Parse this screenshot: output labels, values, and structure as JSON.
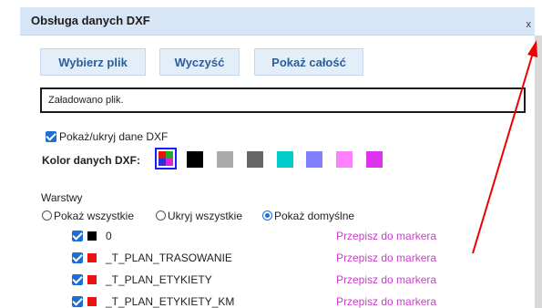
{
  "panel": {
    "title": "Obsługa danych DXF",
    "close_glyph": "x",
    "buttons": [
      "Wybierz plik",
      "Wyczyść",
      "Pokaż całość"
    ],
    "status": "Załadowano plik.",
    "show_toggle_label": "Pokaż/ukryj dane DXF",
    "color_label": "Kolor danych DXF:",
    "colors": [
      "#000000",
      "#aaaaaa",
      "#666666",
      "#00cccc",
      "#8080ff",
      "#ff80ff",
      "#dd33ee"
    ],
    "layers_title": "Warstwy",
    "radio_options": [
      "Pokaż wszystkie",
      "Ukryj wszystkie",
      "Pokaż domyślne"
    ],
    "radio_selected": "Pokaż domyślne",
    "layers": [
      {
        "name": "0",
        "color": "#000000",
        "action": "Przepisz do markera"
      },
      {
        "name": "_T_PLAN_TRASOWANIE",
        "color": "#ee1111",
        "action": "Przepisz do markera"
      },
      {
        "name": "_T_PLAN_ETYKIETY",
        "color": "#ee1111",
        "action": "Przepisz do markera"
      },
      {
        "name": "_T_PLAN_ETYKIETY_KM",
        "color": "#ee1111",
        "action": "Przepisz do markera"
      }
    ]
  },
  "annotation": {
    "arrow_color": "#ee0000"
  }
}
